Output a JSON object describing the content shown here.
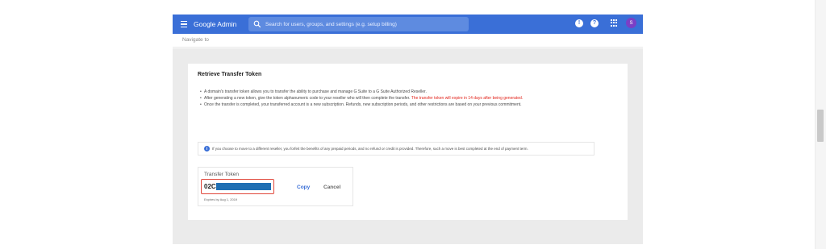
{
  "topbar": {
    "brand": "Google Admin",
    "search_placeholder": "Search for users, groups, and settings (e.g. setup billing)",
    "avatar_initial": "S",
    "colors": {
      "bar": "#3a6fd7",
      "avatar": "#7b3fc6"
    },
    "icons": [
      "menu-icon",
      "search-icon",
      "notifications-icon",
      "help-icon",
      "apps-icon"
    ]
  },
  "nav": {
    "label": "Navigate to"
  },
  "card": {
    "title": "Retrieve Transfer Token",
    "bullets": [
      {
        "text": "A domain's transfer token allows you to transfer the ability to purchase and manage G Suite to a G Suite Authorized Reseller."
      },
      {
        "text": "After generating a new token, give the token alphanumeric code to your reseller who will then complete the transfer. ",
        "warning": "The transfer token will expire in 14 days after being generated."
      },
      {
        "text": "Once the transfer is completed, your transferred account is a new subscription. Refunds, new subscription periods, and other restrictions are based on your previous commitment."
      }
    ],
    "info": "If you choose to move to a different reseller, you forfeit the benefits of any prepaid periods, and no refund or credit is provided. Therefore, such a move is best completed at the end of payment term."
  },
  "token": {
    "label": "Transfer Token",
    "value_prefix": "02C",
    "copy_label": "Copy",
    "cancel_label": "Cancel",
    "expires": "Expires by Aug 1, 2019",
    "highlight_color": "#e0463a",
    "redaction_color": "#1f6fb3"
  }
}
